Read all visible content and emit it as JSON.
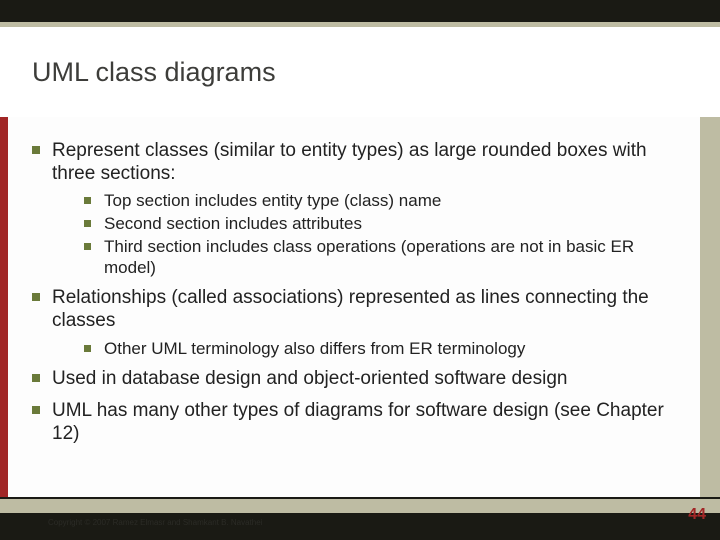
{
  "title": "UML class diagrams",
  "bullets": [
    {
      "text": "Represent classes (similar to entity types) as large rounded boxes with three sections:",
      "sub": [
        "Top section includes entity type (class) name",
        "Second section includes attributes",
        "Third section includes class operations (operations are not in basic ER model)"
      ]
    },
    {
      "text": "Relationships (called associations) represented as lines connecting the classes",
      "sub": [
        "Other UML terminology also differs from ER terminology"
      ]
    },
    {
      "text": "Used in database design and object-oriented software design",
      "sub": []
    },
    {
      "text": "UML has many other types of diagrams for software design (see Chapter 12)",
      "sub": []
    }
  ],
  "copyright": "Copyright © 2007 Ramez Elmasr and Shamkant B. Navathei",
  "pageNumber": "44"
}
